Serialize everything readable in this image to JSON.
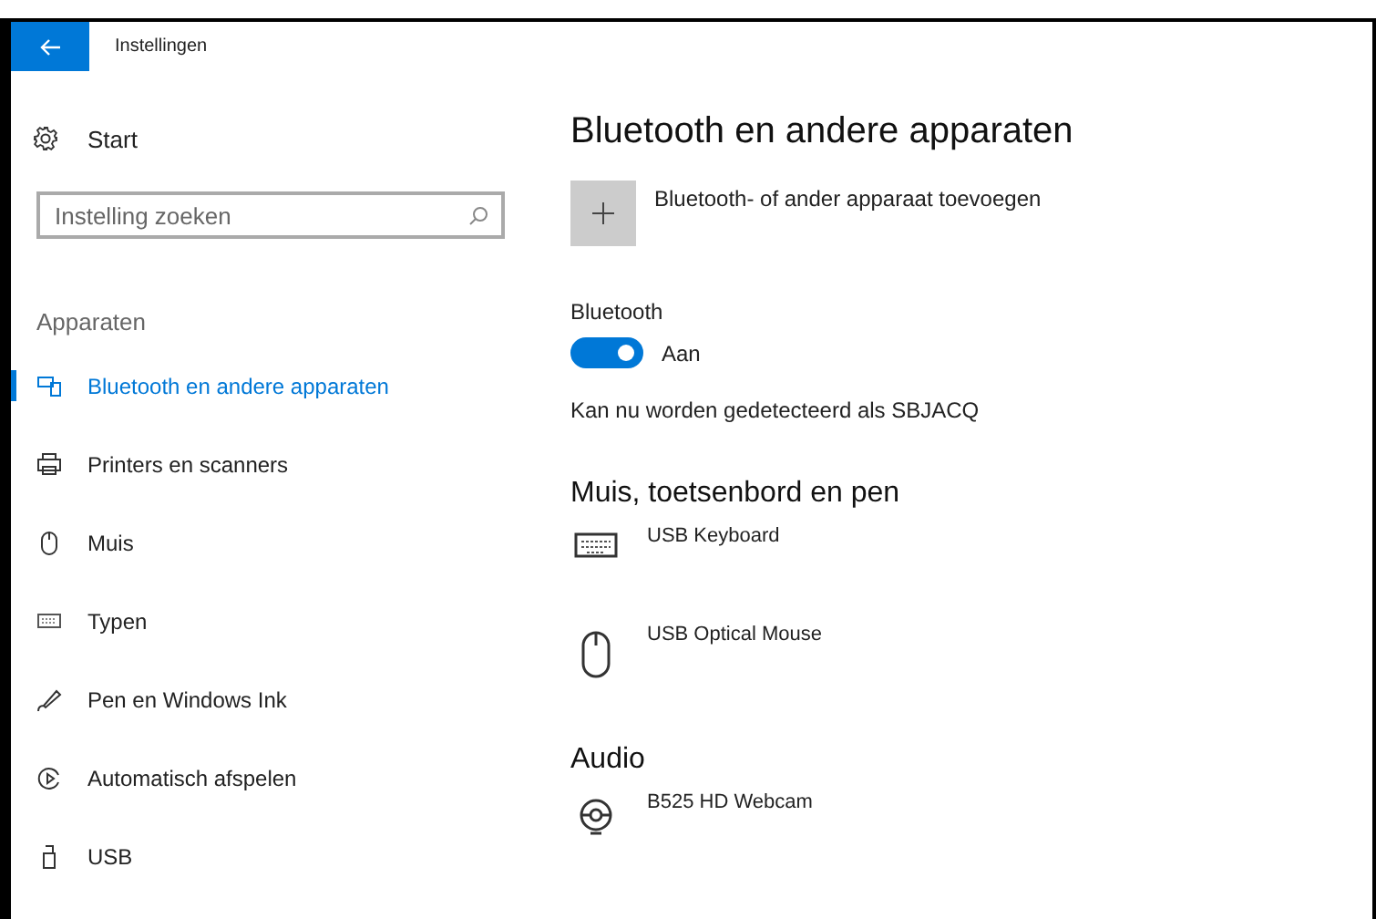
{
  "window": {
    "title": "Instellingen"
  },
  "sidebar": {
    "home": "Start",
    "search": {
      "placeholder": "Instelling zoeken"
    },
    "section": "Apparaten",
    "items": [
      {
        "label": "Bluetooth en andere apparaten",
        "kind": "bluetooth",
        "selected": true
      },
      {
        "label": "Printers en scanners",
        "kind": "printer",
        "selected": false
      },
      {
        "label": "Muis",
        "kind": "mouse",
        "selected": false
      },
      {
        "label": "Typen",
        "kind": "keyboard",
        "selected": false
      },
      {
        "label": "Pen en Windows Ink",
        "kind": "pen",
        "selected": false
      },
      {
        "label": "Automatisch afspelen",
        "kind": "autoplay",
        "selected": false
      },
      {
        "label": "USB",
        "kind": "usb",
        "selected": false
      }
    ]
  },
  "content": {
    "title": "Bluetooth en andere apparaten",
    "add_label": "Bluetooth- of ander apparaat toevoegen",
    "bluetooth": {
      "label": "Bluetooth",
      "on": true,
      "state": "Aan"
    },
    "discoverable": "Kan nu worden gedetecteerd als SBJACQ",
    "groups": [
      {
        "title": "Muis, toetsenbord en pen",
        "devices": [
          {
            "name": "USB Keyboard",
            "kind": "keyboard"
          },
          {
            "name": "USB Optical Mouse",
            "kind": "mouse"
          }
        ]
      },
      {
        "title": "Audio",
        "devices": [
          {
            "name": "B525 HD Webcam",
            "kind": "webcam"
          }
        ]
      }
    ]
  }
}
